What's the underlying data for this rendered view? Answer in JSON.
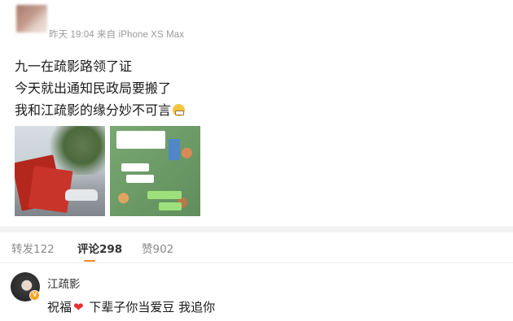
{
  "post": {
    "meta": "昨天 19:04 来自 iPhone XS Max",
    "lines": [
      "九一在疏影路领了证",
      "今天就出通知民政局要搬了",
      "我和江疏影的缘分妙不可言"
    ],
    "emoji": "grimacing-face",
    "photos": [
      "marriage-certificate-photo",
      "chat-screenshot-photo"
    ]
  },
  "tabs": {
    "repost": "转发122",
    "comment": "评论298",
    "like": "赞902",
    "active": "comment",
    "accent_color": "#f58b1f"
  },
  "comment": {
    "author": "江疏影",
    "text_before": "祝福",
    "heart": "❤",
    "text_after": " 下辈子你当爱豆 我追你",
    "badge_color": "#f5a623"
  }
}
